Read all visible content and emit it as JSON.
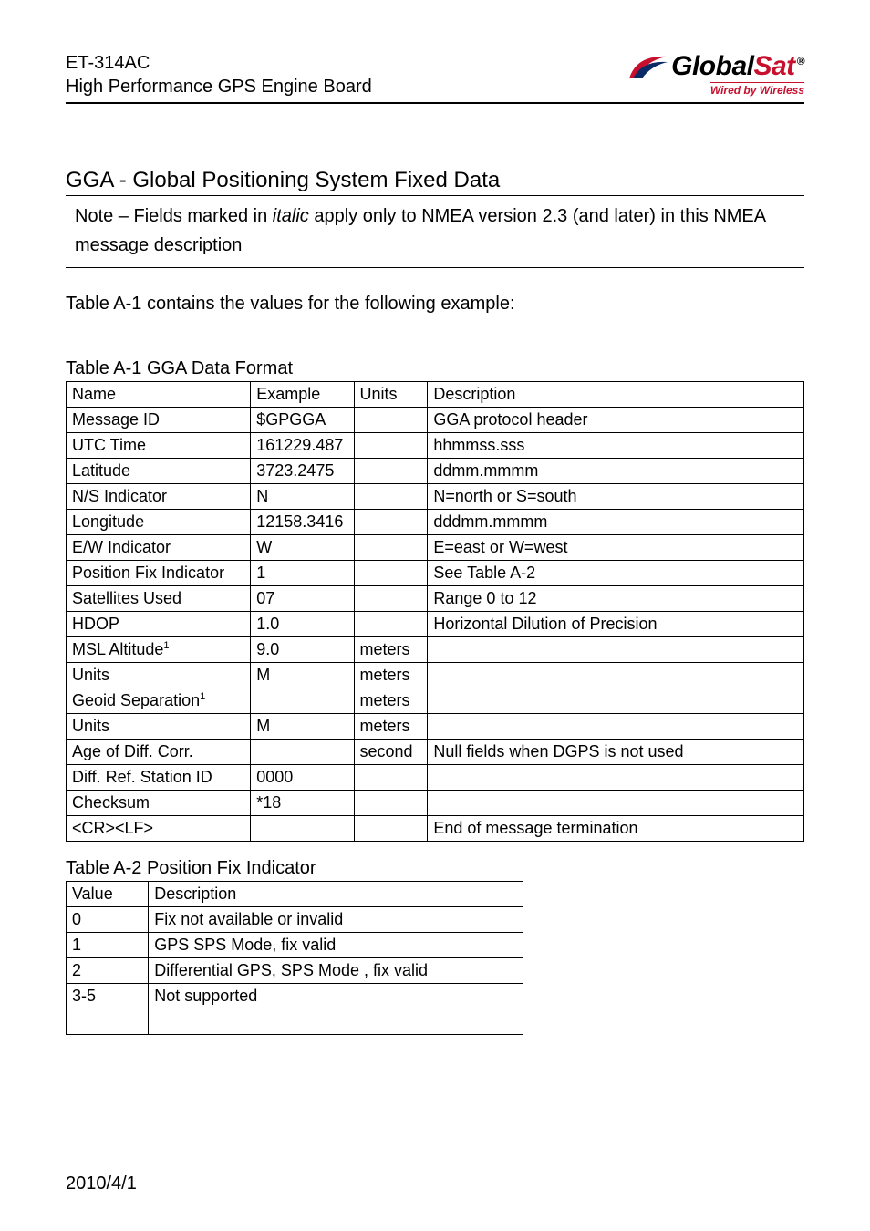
{
  "header": {
    "line1": "ET-314AC",
    "line2": "High Performance GPS Engine Board",
    "logo_main": "Global",
    "logo_accent": "Sat",
    "logo_reg": "®",
    "logo_sub": "Wired by Wireless"
  },
  "section": {
    "title": "GGA - Global Positioning System Fixed Data",
    "note_prefix": "Note – Fields marked in ",
    "note_italic": "italic",
    "note_rest": "       apply only to NMEA version 2.3 (and later) in this NMEA message description"
  },
  "para1": "Table A-1 contains the values for the following example:",
  "table_a1": {
    "caption": "Table A-1 GGA Data Format",
    "head": [
      "Name",
      "Example",
      "Units",
      "Description"
    ],
    "rows": [
      [
        "Message ID",
        "$GPGGA",
        "",
        "GGA protocol header"
      ],
      [
        "UTC Time",
        "161229.487",
        "",
        "hhmmss.sss"
      ],
      [
        "Latitude",
        "3723.2475",
        "",
        "ddmm.mmmm"
      ],
      [
        "N/S Indicator",
        "N",
        "",
        "N=north or S=south"
      ],
      [
        "Longitude",
        "12158.3416",
        "",
        "dddmm.mmmm"
      ],
      [
        "E/W Indicator",
        "W",
        "",
        "E=east or W=west"
      ],
      [
        "Position Fix Indicator",
        "1",
        "",
        "See Table A-2"
      ],
      [
        "Satellites Used",
        "07",
        "",
        "Range 0 to 12"
      ],
      [
        "HDOP",
        "1.0",
        "",
        "Horizontal Dilution of Precision"
      ],
      [
        "MSL Altitude",
        "9.0",
        "meters",
        ""
      ],
      [
        "Units",
        "M",
        "meters",
        ""
      ],
      [
        "Geoid Separation",
        "",
        "meters",
        ""
      ],
      [
        "Units",
        "M",
        "meters",
        ""
      ],
      [
        "Age of Diff. Corr.",
        "",
        "second",
        "Null fields when DGPS is not used"
      ],
      [
        "Diff. Ref. Station ID",
        "0000",
        "",
        ""
      ],
      [
        "Checksum",
        "*18",
        "",
        ""
      ],
      [
        "<CR><LF>",
        "",
        "",
        "End of message termination"
      ]
    ],
    "sup_rows": [
      9,
      11
    ]
  },
  "table_a2": {
    "caption": "Table A-2 Position Fix Indicator",
    "head": [
      "Value",
      "Description"
    ],
    "rows": [
      [
        "0",
        "Fix not available or invalid"
      ],
      [
        "1",
        "GPS SPS Mode, fix valid"
      ],
      [
        "2",
        "Differential GPS, SPS Mode , fix valid"
      ],
      [
        "3-5",
        "Not supported"
      ],
      [
        "",
        ""
      ]
    ]
  },
  "footer": "2010/4/1"
}
